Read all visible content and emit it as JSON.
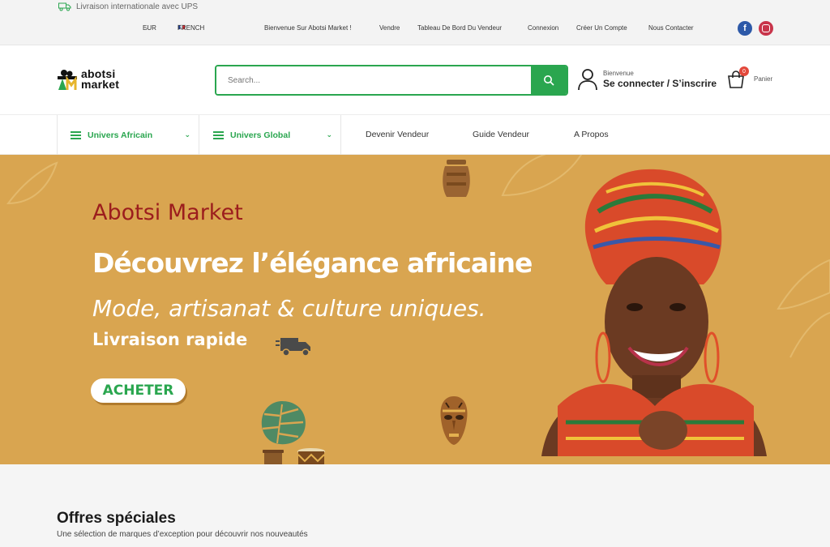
{
  "topbar": {
    "shipping_text": "Livraison internationale avec UPS",
    "currency": "EUR",
    "language": "FRENCH",
    "links": [
      "Bienvenue Sur Abotsi Market !",
      "Vendre",
      "Tableau De Bord Du Vendeur",
      "Connexion",
      "Créer Un Compte",
      "Nous Contacter"
    ],
    "social": [
      "facebook-icon",
      "instagram-icon"
    ]
  },
  "header": {
    "logo_line1": "abotsi",
    "logo_line2": "market",
    "search_placeholder": "Search...",
    "account_small": "Bienvenue",
    "account_big": "Se connecter / S’inscrire",
    "cart_count": "0",
    "cart_label": "Panier"
  },
  "catnav": {
    "cat1": "Univers Africain",
    "cat2": "Univers Global",
    "links": [
      "Devenir Vendeur",
      "Guide Vendeur",
      "A Propos"
    ]
  },
  "hero": {
    "brand": "Abotsi Market",
    "headline": "Découvrez l’élégance africaine",
    "tagline": "Mode, artisanat & culture uniques.",
    "delivery": "Livraison rapide",
    "cta": "ACHETER"
  },
  "offers": {
    "title": "Offres spéciales",
    "subtitle": "Une sélection de marques d’exception pour découvrir nos nouveautés"
  },
  "colors": {
    "brand_green": "#2aa64f",
    "hero_bg": "#d9a550",
    "hero_brand_red": "#9c1d1d"
  }
}
